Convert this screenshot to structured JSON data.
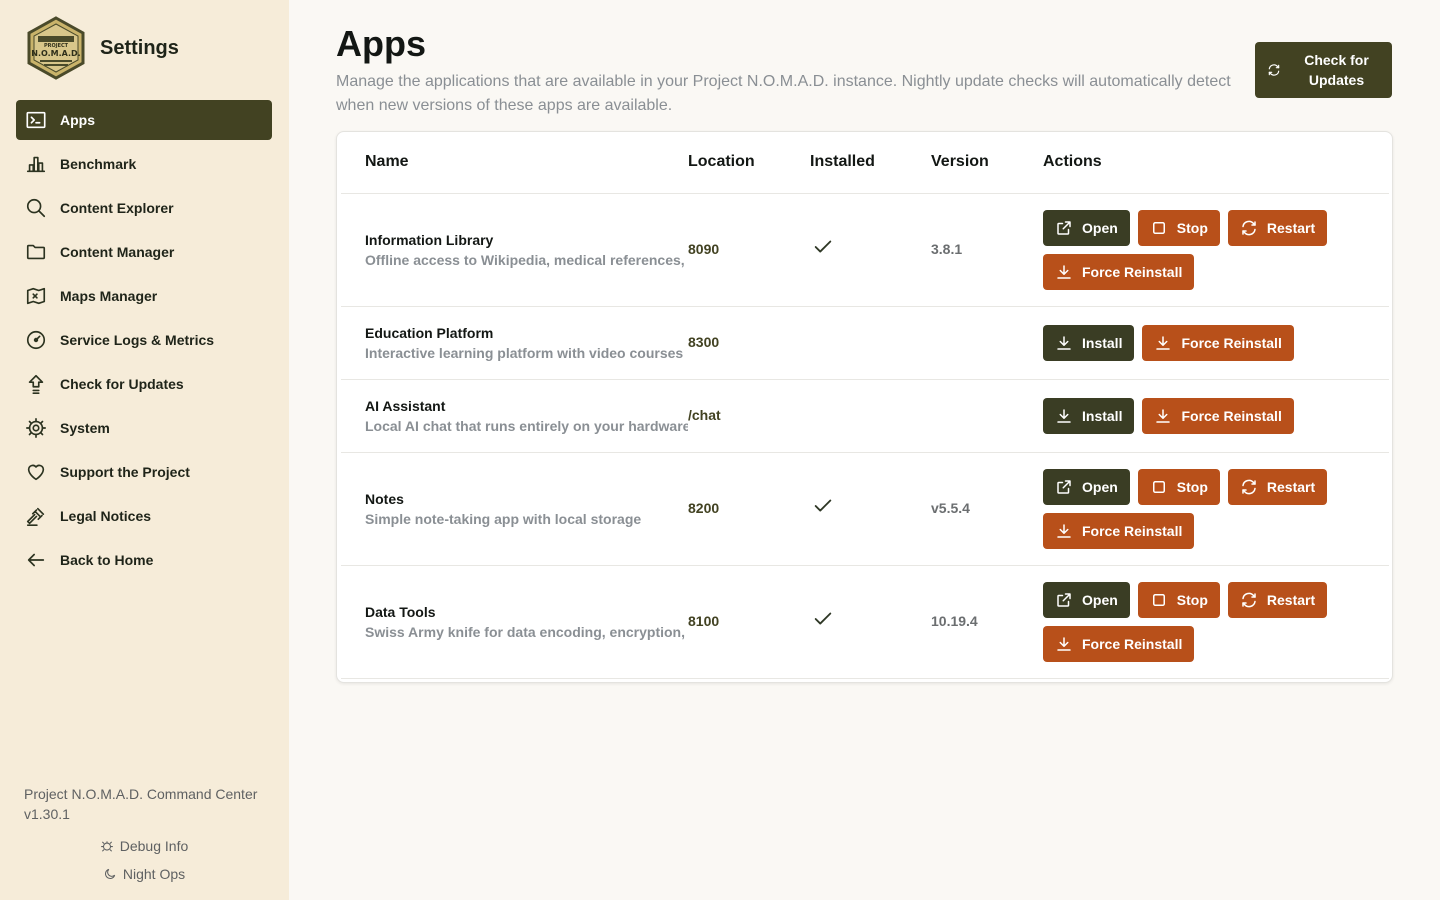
{
  "sidebar": {
    "title": "Settings",
    "logo": {
      "top": "PROJECT",
      "main": "N.O.M.A.D."
    },
    "items": [
      {
        "label": "Apps",
        "icon": "terminal-icon",
        "active": true
      },
      {
        "label": "Benchmark",
        "icon": "chart-bar-icon"
      },
      {
        "label": "Content Explorer",
        "icon": "search-icon"
      },
      {
        "label": "Content Manager",
        "icon": "folder-icon"
      },
      {
        "label": "Maps Manager",
        "icon": "map-icon"
      },
      {
        "label": "Service Logs & Metrics",
        "icon": "gauge-icon"
      },
      {
        "label": "Check for Updates",
        "icon": "upload-arrow-icon"
      },
      {
        "label": "System",
        "icon": "gear-icon"
      },
      {
        "label": "Support the Project",
        "icon": "heart-icon"
      },
      {
        "label": "Legal Notices",
        "icon": "gavel-icon"
      }
    ],
    "back_label": "Back to Home",
    "footer": {
      "version_line": "Project N.O.M.A.D. Command Center v1.30.1",
      "debug_label": "Debug Info",
      "night_label": "Night Ops"
    }
  },
  "page": {
    "title": "Apps",
    "description": "Manage the applications that are available in your Project N.O.M.A.D. instance. Nightly update checks will automatically detect when new versions of these apps are available.",
    "check_updates_label": "Check for Updates"
  },
  "table": {
    "headers": {
      "name": "Name",
      "location": "Location",
      "installed": "Installed",
      "version": "Version",
      "actions": "Actions"
    },
    "labels": {
      "open": "Open",
      "stop": "Stop",
      "restart": "Restart",
      "force_reinstall": "Force Reinstall",
      "install": "Install"
    },
    "rows": [
      {
        "name": "Information Library",
        "desc": "Offline access to Wikipedia, medical references,",
        "location": "8090",
        "version": "3.8.1"
      },
      {
        "name": "Education Platform",
        "desc": "Interactive learning platform with video courses",
        "location": "8300",
        "version": ""
      },
      {
        "name": "AI Assistant",
        "desc": "Local AI chat that runs entirely on your hardware",
        "location": "/chat",
        "version": ""
      },
      {
        "name": "Notes",
        "desc": "Simple note-taking app with local storage",
        "location": "8200",
        "version": "v5.5.4"
      },
      {
        "name": "Data Tools",
        "desc": "Swiss Army knife for data encoding, encryption,",
        "location": "8100",
        "version": "10.19.4"
      }
    ]
  },
  "colors": {
    "primary": "#424222",
    "accent": "#b8501a",
    "sidebar_bg": "#f6ecd9",
    "page_bg": "#faf8f4"
  }
}
